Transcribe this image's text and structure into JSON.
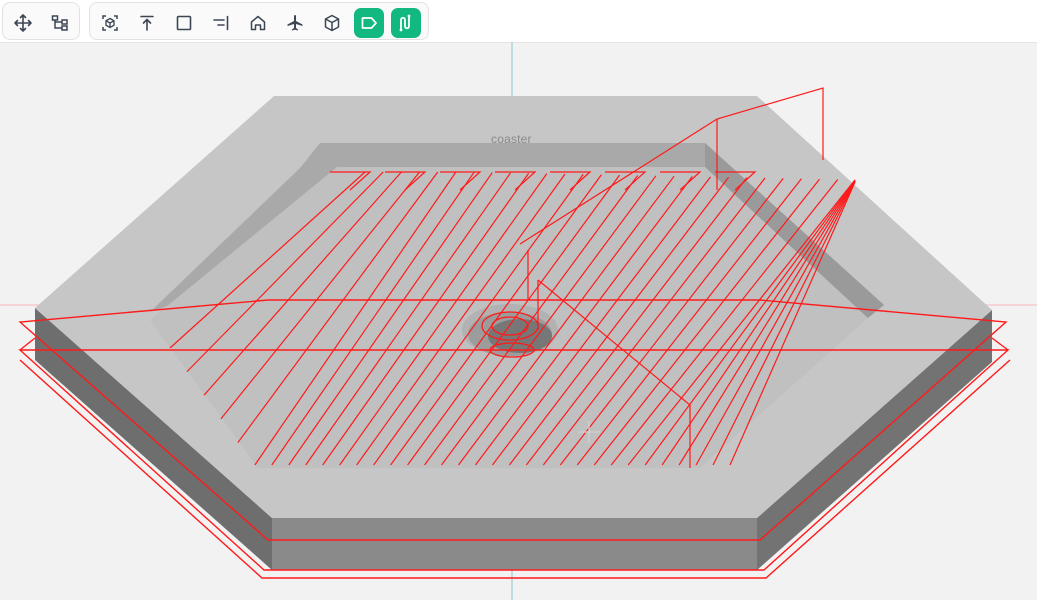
{
  "toolbar": {
    "group_left": [
      {
        "icon": "move-icon",
        "label": ""
      },
      {
        "icon": "hierarchy-icon",
        "label": ""
      }
    ],
    "group_right": [
      {
        "icon": "frame-object-icon",
        "active": false
      },
      {
        "icon": "align-top-icon",
        "active": false
      },
      {
        "icon": "square-view-icon",
        "active": false
      },
      {
        "icon": "align-right-icon",
        "active": false
      },
      {
        "icon": "home-icon",
        "active": false
      },
      {
        "icon": "airplane-icon",
        "active": false
      },
      {
        "icon": "cube-icon",
        "active": false
      },
      {
        "icon": "tag-icon",
        "active": true
      },
      {
        "icon": "toolpath-icon",
        "active": true
      }
    ],
    "active_color": "#11b981"
  },
  "viewport": {
    "object_label": "coaster",
    "toolpath_color": "#ff1a1a",
    "model_color": "#c4c4c4"
  }
}
